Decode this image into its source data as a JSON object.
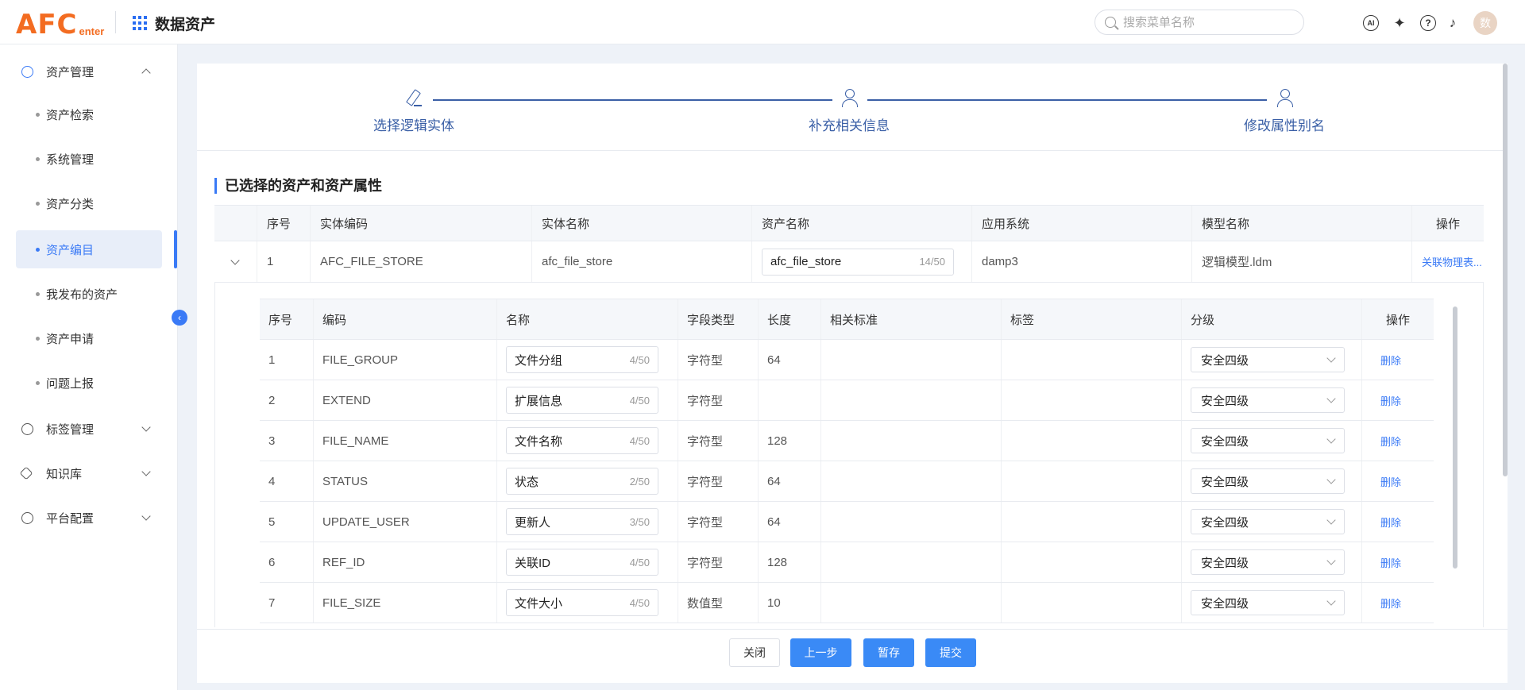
{
  "header": {
    "logo_main": "AFC",
    "logo_sub": "enter",
    "app_title": "数据资产",
    "search_placeholder": "搜索菜单名称",
    "ai_label": "AI",
    "help_label": "?",
    "avatar_text": "数"
  },
  "sidebar": {
    "groups": [
      {
        "label": "资产管理"
      },
      {
        "label": "标签管理"
      },
      {
        "label": "知识库"
      },
      {
        "label": "平台配置"
      }
    ],
    "items": [
      {
        "label": "资产检索"
      },
      {
        "label": "系统管理"
      },
      {
        "label": "资产分类"
      },
      {
        "label": "资产编目"
      },
      {
        "label": "我发布的资产"
      },
      {
        "label": "资产申请"
      },
      {
        "label": "问题上报"
      }
    ]
  },
  "steps": [
    {
      "label": "选择逻辑实体"
    },
    {
      "label": "补充相关信息"
    },
    {
      "label": "修改属性别名"
    }
  ],
  "section_title": "已选择的资产和资产属性",
  "outer_table": {
    "headers": [
      "序号",
      "实体编码",
      "实体名称",
      "资产名称",
      "应用系统",
      "模型名称",
      "操作"
    ],
    "row": {
      "index": "1",
      "code": "AFC_FILE_STORE",
      "name": "afc_file_store",
      "asset_name": "afc_file_store",
      "asset_count": "14/50",
      "system": "damp3",
      "model": "逻辑模型.ldm",
      "action": "关联物理表..."
    }
  },
  "inner_table": {
    "headers": [
      "序号",
      "编码",
      "名称",
      "字段类型",
      "长度",
      "相关标准",
      "标签",
      "分级",
      "操作"
    ],
    "rows": [
      {
        "index": "1",
        "code": "FILE_GROUP",
        "name": "文件分组",
        "count": "4/50",
        "type": "字符型",
        "length": "64",
        "level": "安全四级",
        "action": "删除"
      },
      {
        "index": "2",
        "code": "EXTEND",
        "name": "扩展信息",
        "count": "4/50",
        "type": "字符型",
        "length": "",
        "level": "安全四级",
        "action": "删除"
      },
      {
        "index": "3",
        "code": "FILE_NAME",
        "name": "文件名称",
        "count": "4/50",
        "type": "字符型",
        "length": "128",
        "level": "安全四级",
        "action": "删除"
      },
      {
        "index": "4",
        "code": "STATUS",
        "name": "状态",
        "count": "2/50",
        "type": "字符型",
        "length": "64",
        "level": "安全四级",
        "action": "删除"
      },
      {
        "index": "5",
        "code": "UPDATE_USER",
        "name": "更新人",
        "count": "3/50",
        "type": "字符型",
        "length": "64",
        "level": "安全四级",
        "action": "删除"
      },
      {
        "index": "6",
        "code": "REF_ID",
        "name": "关联ID",
        "count": "4/50",
        "type": "字符型",
        "length": "128",
        "level": "安全四级",
        "action": "删除"
      },
      {
        "index": "7",
        "code": "FILE_SIZE",
        "name": "文件大小",
        "count": "4/50",
        "type": "数值型",
        "length": "10",
        "level": "安全四级",
        "action": "删除"
      }
    ]
  },
  "footer": {
    "close": "关闭",
    "prev": "上一步",
    "save": "暂存",
    "submit": "提交"
  },
  "colors": {
    "accent": "#3a7af6",
    "logo": "#f36c21",
    "step": "#3a5fa6"
  }
}
